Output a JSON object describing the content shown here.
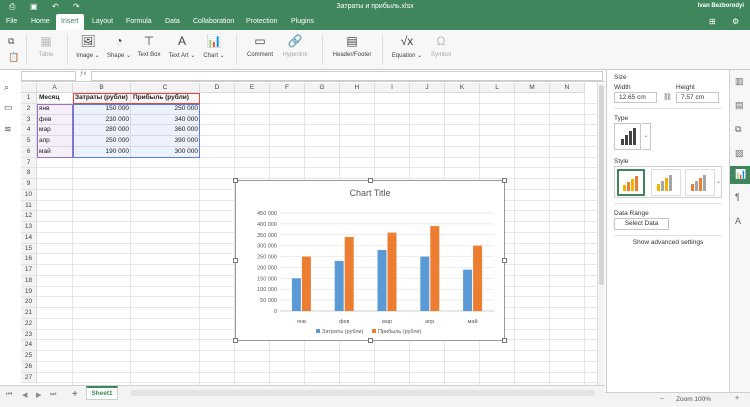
{
  "titlebar": {
    "doc_title": "Затраты и прибыль.xlsx",
    "user": "Ivan Bezborodyi"
  },
  "menu": {
    "tabs": [
      "File",
      "Home",
      "Insert",
      "Layout",
      "Formula",
      "Data",
      "Collaboration",
      "Protection",
      "Plugins"
    ],
    "active": "Insert"
  },
  "toolbar": {
    "table": "Table",
    "image": "Image",
    "shape": "Shape",
    "textbox": "Text Box",
    "textart": "Text Art",
    "chart": "Chart",
    "comment": "Comment",
    "hyperlink": "Hyperlink",
    "headerfooter": "Header/Footer",
    "equation": "Equation",
    "symbol": "Symbol"
  },
  "sheet": {
    "columns": [
      "A",
      "B",
      "C",
      "D",
      "E",
      "F",
      "G",
      "H",
      "I",
      "J",
      "K",
      "L",
      "M",
      "N"
    ],
    "rows": [
      "1",
      "2",
      "3",
      "4",
      "5",
      "6",
      "7",
      "8",
      "9",
      "10",
      "11",
      "12",
      "13",
      "14",
      "15",
      "16",
      "17",
      "18",
      "19",
      "20",
      "21",
      "22",
      "23",
      "24",
      "25",
      "26",
      "27"
    ],
    "headers": [
      "Месяц",
      "Затраты (рубли)",
      "Прибыль (рубли)"
    ],
    "data": [
      [
        "янв",
        "150 000",
        "250 000"
      ],
      [
        "фев",
        "230 000",
        "340 000"
      ],
      [
        "мар",
        "280 000",
        "360 000"
      ],
      [
        "апр",
        "250 000",
        "390 000"
      ],
      [
        "май",
        "190 000",
        "300 000"
      ]
    ]
  },
  "chart_data": {
    "type": "bar",
    "title": "Chart Title",
    "categories": [
      "янв",
      "фев",
      "мар",
      "апр",
      "май"
    ],
    "series": [
      {
        "name": "Затраты (рубли)",
        "values": [
          150000,
          230000,
          280000,
          250000,
          190000
        ],
        "color": "#5b9bd5"
      },
      {
        "name": "Прибыль (рубли)",
        "values": [
          250000,
          340000,
          360000,
          390000,
          300000
        ],
        "color": "#ed7d31"
      }
    ],
    "y_ticks": [
      "0",
      "50 000",
      "100 000",
      "150 000",
      "200 000",
      "250 000",
      "300 000",
      "350 000",
      "400 000",
      "450 000"
    ],
    "ylim": [
      0,
      450000
    ],
    "legend": "bottom",
    "grid": true
  },
  "sheet_tabs": {
    "active": "Sheet1"
  },
  "status": {
    "zoom": "Zoom 100%"
  },
  "panel": {
    "size": "Size",
    "width_label": "Width",
    "width_value": "12.65 cm",
    "height_label": "Height",
    "height_value": "7.57 cm",
    "type": "Type",
    "style": "Style",
    "data_range": "Data Range",
    "select_data": "Select Data",
    "advanced": "Show advanced settings"
  }
}
